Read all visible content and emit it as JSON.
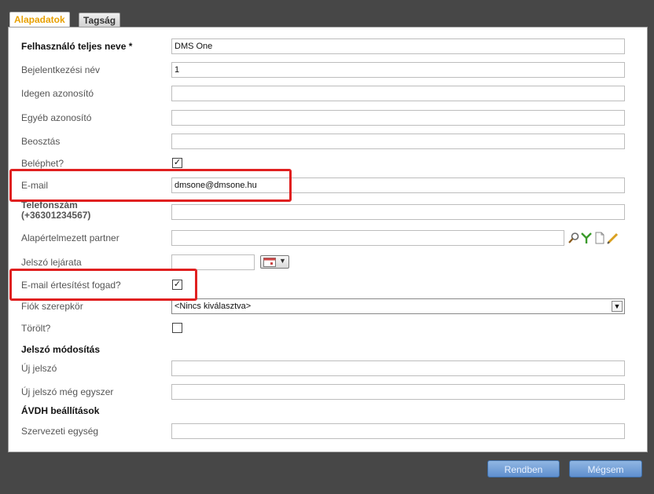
{
  "tabs": [
    {
      "label": "Alapadatok",
      "active": true
    },
    {
      "label": "Tagság",
      "active": false
    }
  ],
  "fields": {
    "full_name": {
      "label": "Felhasználó teljes neve *",
      "value": "DMS One"
    },
    "login": {
      "label": "Bejelentkezési név",
      "value": "1"
    },
    "foreign_id": {
      "label": "Idegen azonosító",
      "value": ""
    },
    "other_id": {
      "label": "Egyéb azonosító",
      "value": ""
    },
    "position": {
      "label": "Beosztás",
      "value": ""
    },
    "can_login": {
      "label": "Beléphet?",
      "checked": true
    },
    "email": {
      "label": "E-mail",
      "value": "dmsone@dmsone.hu"
    },
    "phone": {
      "label_line1": "Telefonszám",
      "label_line2": "(+36301234567)",
      "value": ""
    },
    "default_partner": {
      "label": "Alapértelmezett partner",
      "value": ""
    },
    "password_expiry": {
      "label": "Jelszó lejárata",
      "value": ""
    },
    "email_notify": {
      "label": "E-mail értesítést fogad?",
      "checked": true
    },
    "account_role": {
      "label": "Fiók szerepkör",
      "value": "<Nincs kiválasztva>"
    },
    "deleted": {
      "label": "Törölt?",
      "checked": false
    }
  },
  "password_section": {
    "title": "Jelszó módosítás",
    "new_password": {
      "label": "Új jelszó",
      "value": ""
    },
    "new_password_again": {
      "label": "Új jelszó még egyszer",
      "value": ""
    }
  },
  "avdh_section": {
    "title": "ÁVDH beállítások",
    "org_unit": {
      "label": "Szervezeti egység",
      "value": ""
    }
  },
  "checkmark": "✓",
  "buttons": {
    "ok": "Rendben",
    "cancel": "Mégsem"
  },
  "colors": {
    "highlight": "#e02020",
    "active_tab": "#e8a000",
    "button": "#6f9bd6"
  }
}
